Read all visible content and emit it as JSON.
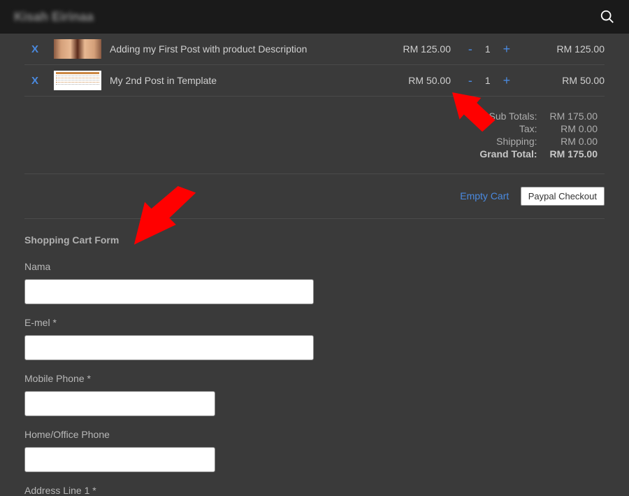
{
  "header": {
    "title": "Kisah Eirinaa"
  },
  "cart": {
    "items": [
      {
        "name": "Adding my First Post with product Description",
        "price": "RM 125.00",
        "qty": "1",
        "line_total": "RM 125.00"
      },
      {
        "name": "My 2nd Post in Template",
        "price": "RM 50.00",
        "qty": "1",
        "line_total": "RM 50.00"
      }
    ],
    "remove_symbol": "X",
    "minus_symbol": "-",
    "plus_symbol": "+",
    "totals": {
      "subtotal_label": "Sub Totals:",
      "subtotal_value": "RM 175.00",
      "tax_label": "Tax:",
      "tax_value": "RM 0.00",
      "shipping_label": "Shipping:",
      "shipping_value": "RM 0.00",
      "grand_label": "Grand Total:",
      "grand_value": "RM 175.00"
    },
    "empty_cart_label": "Empty Cart",
    "paypal_label": "Paypal Checkout"
  },
  "form": {
    "title": "Shopping Cart Form",
    "fields": {
      "nama_label": "Nama",
      "email_label": "E-mel *",
      "mobile_label": "Mobile Phone *",
      "home_label": "Home/Office Phone",
      "address_label": "Address Line 1 *"
    }
  }
}
